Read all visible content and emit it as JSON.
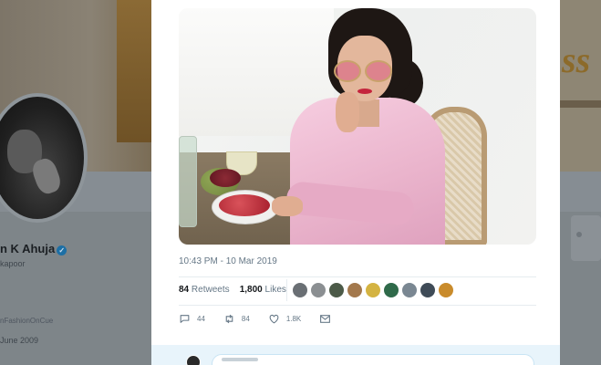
{
  "profile": {
    "name": "n K Ahuja",
    "verified": "✓",
    "handle": "kapoor",
    "website": "nFashionOnCue",
    "joined": "June 2009"
  },
  "tweet": {
    "timestamp": "10:43 PM - 10 Mar 2019",
    "retweets_count": "84",
    "retweets_label": "Retweets",
    "likes_count": "1,800",
    "likes_label": "Likes",
    "reply_count": "44",
    "retweet_action_count": "84",
    "like_action_count": "1.8K"
  },
  "liker_avatars": [
    {
      "color": "#6a6f74"
    },
    {
      "color": "#8b8f92"
    },
    {
      "color": "#4c5a48"
    },
    {
      "color": "#a3784c"
    },
    {
      "color": "#d4b341"
    },
    {
      "color": "#2f6a4a"
    },
    {
      "color": "#7a8792"
    },
    {
      "color": "#3f4b57"
    },
    {
      "color": "#c98b2b"
    }
  ],
  "colors": {
    "accent": "#1da1f2",
    "text_secondary": "#657786",
    "text_primary": "#14171a",
    "verified": "#1d6fa5"
  },
  "icons": [
    "reply-icon",
    "retweet-icon",
    "like-icon",
    "direct-message-icon"
  ]
}
